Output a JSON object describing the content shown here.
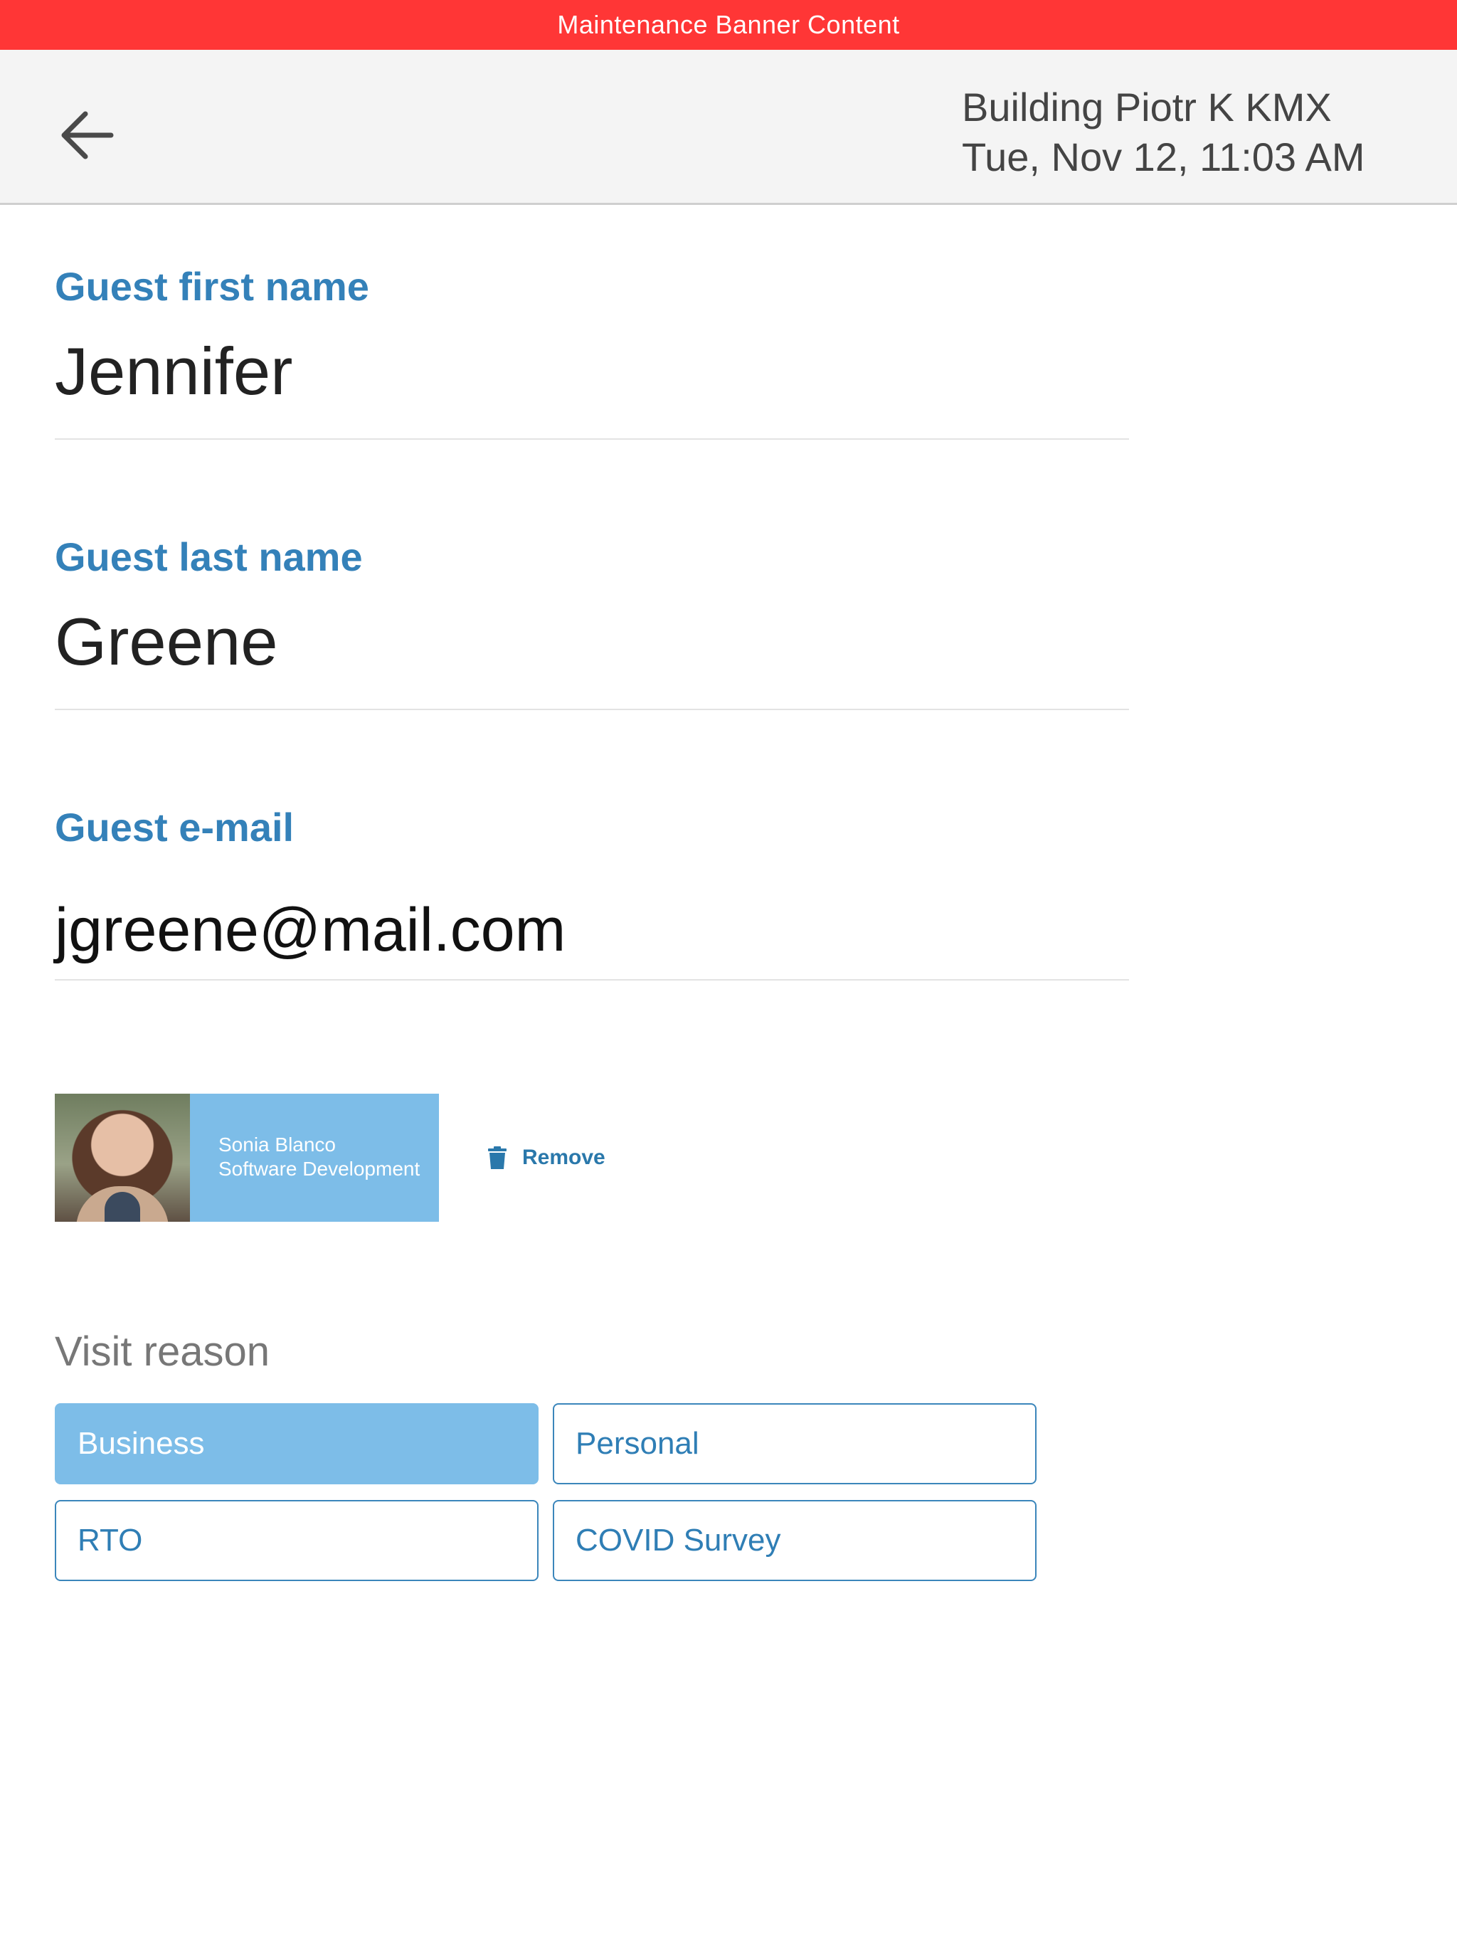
{
  "banner": {
    "text": "Maintenance Banner Content",
    "color": "#ff3636"
  },
  "header": {
    "back_icon": "arrow-left-icon",
    "building": "Building Piotr K KMX",
    "datetime": "Tue, Nov 12, 11:03 AM"
  },
  "form": {
    "first_name": {
      "label": "Guest first name",
      "value": "Jennifer"
    },
    "last_name": {
      "label": "Guest last name",
      "value": "Greene"
    },
    "email": {
      "label": "Guest e-mail",
      "value": "jgreene@mail.com"
    }
  },
  "host": {
    "name": "Sonia Blanco",
    "department": "Software Development",
    "remove_label": "Remove",
    "remove_icon": "trash-icon"
  },
  "visit": {
    "title": "Visit reason",
    "options": [
      {
        "label": "Business",
        "selected": true
      },
      {
        "label": "Personal",
        "selected": false
      },
      {
        "label": "RTO",
        "selected": false
      },
      {
        "label": "COVID Survey",
        "selected": false
      }
    ]
  },
  "colors": {
    "accent": "#3481b9",
    "selected_fill": "#7dbde8",
    "header_bg": "#f4f4f4"
  }
}
